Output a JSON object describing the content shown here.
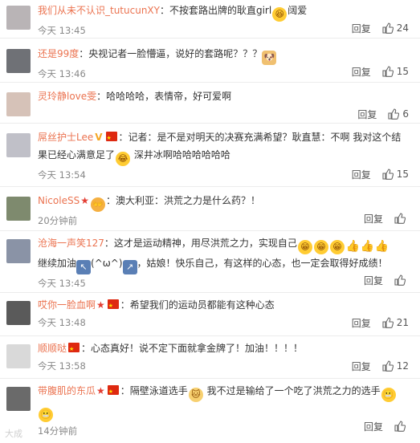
{
  "actions": {
    "reply_label": "回复"
  },
  "comments": [
    {
      "user": "我们从未不认识_tutucunXY",
      "badges": [],
      "text": "：不按套路出牌的耿直girl",
      "emoji_after": [
        "laugh-emoji"
      ],
      "text2": "阔爱",
      "time": "今天 13:45",
      "likes": "24",
      "avatar_color": "#b9b4b6"
    },
    {
      "user": "还是99度",
      "badges": [],
      "text": "：央视记者一脸懵逼，说好的套路呢？？？",
      "emoji_after": [
        "doge-emoji"
      ],
      "text2": "",
      "time": "今天 13:46",
      "likes": "15",
      "avatar_color": "#6f7176"
    },
    {
      "user": "灵玲静love雯",
      "badges": [],
      "text": "：哈哈哈哈，表情帝，好可爱啊",
      "emoji_after": [],
      "text2": "",
      "time": "",
      "likes": "6",
      "avatar_color": "#d6c2b8"
    },
    {
      "user": "屌丝护士Lee",
      "badges": [
        "v",
        "flag"
      ],
      "text": "：记者：是不是对明天的决赛充满希望？耿直慧：不啊 我对这个结",
      "line2": "果已经心满意足了",
      "line2_emoji": "laugh-emoji",
      "line2_text": "深井冰啊哈哈哈哈哈哈",
      "time": "今天 13:54",
      "likes": "15",
      "avatar_color": "#c0c0c8"
    },
    {
      "user": "NicoleSS",
      "badges": [
        "star",
        "hands"
      ],
      "text": "：澳大利亚：洪荒之力是什么药？！",
      "time": "20分钟前",
      "likes": "",
      "avatar_color": "#7e8a6e"
    },
    {
      "user": "沧海一声笑127",
      "badges": [],
      "text": "：这才是运动精神，用尽洪荒之力，实现自己",
      "line2_start": "继续加油",
      "kaomoji": "(^ω^)",
      "line2_text": "，姑娘！快乐自己，有这样的心态，也一定会取得好成绩！",
      "time": "今天 13:45",
      "likes": "",
      "avatar_color": "#8a93a6"
    },
    {
      "user": "哎你一脸血啊",
      "badges": [
        "star",
        "flag"
      ],
      "text": "：希望我们的运动员都能有这种心态",
      "time": "今天 13:48",
      "likes": "21",
      "avatar_color": "#5a5a5a"
    },
    {
      "user": "顺顺哒",
      "badges": [
        "flag"
      ],
      "text": "：心态真好！说不定下面就拿金牌了！加油！！！！",
      "time": "今天 13:58",
      "likes": "12",
      "avatar_color": "#d9d9d9"
    },
    {
      "user": "带腹肌的东瓜",
      "badges": [
        "star",
        "flag"
      ],
      "text": "：隔壁泳道选手",
      "emoji_after": [
        "cat-emoji"
      ],
      "text2": "我不过是输给了一个吃了洪荒之力的选手",
      "time": "14分钟前",
      "likes": "",
      "avatar_color": "#6a6a6a"
    }
  ],
  "watermark": "大成"
}
